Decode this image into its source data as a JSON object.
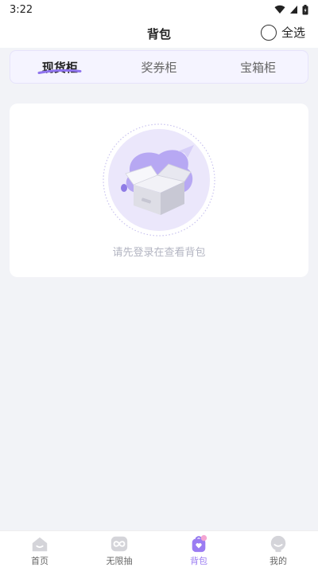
{
  "status_bar": {
    "time": "3:22",
    "icons": [
      "wifi-icon",
      "signal-icon",
      "battery-icon"
    ]
  },
  "header": {
    "title": "背包",
    "select_all_label": "全选"
  },
  "tabs": [
    {
      "label": "现货柜",
      "active": true
    },
    {
      "label": "奖券柜",
      "active": false
    },
    {
      "label": "宝箱柜",
      "active": false
    }
  ],
  "empty_state": {
    "message": "请先登录在查看背包",
    "icon": "empty-box-icon"
  },
  "bottom_nav": [
    {
      "label": "首页",
      "icon": "home-icon",
      "active": false
    },
    {
      "label": "无限抽",
      "icon": "infinity-icon",
      "active": false
    },
    {
      "label": "背包",
      "icon": "backpack-icon",
      "active": true
    },
    {
      "label": "我的",
      "icon": "profile-icon",
      "active": false
    }
  ],
  "colors": {
    "accent": "#9b7cf2",
    "background": "#f2f3f7",
    "tab_bg": "#f5f4ff"
  }
}
